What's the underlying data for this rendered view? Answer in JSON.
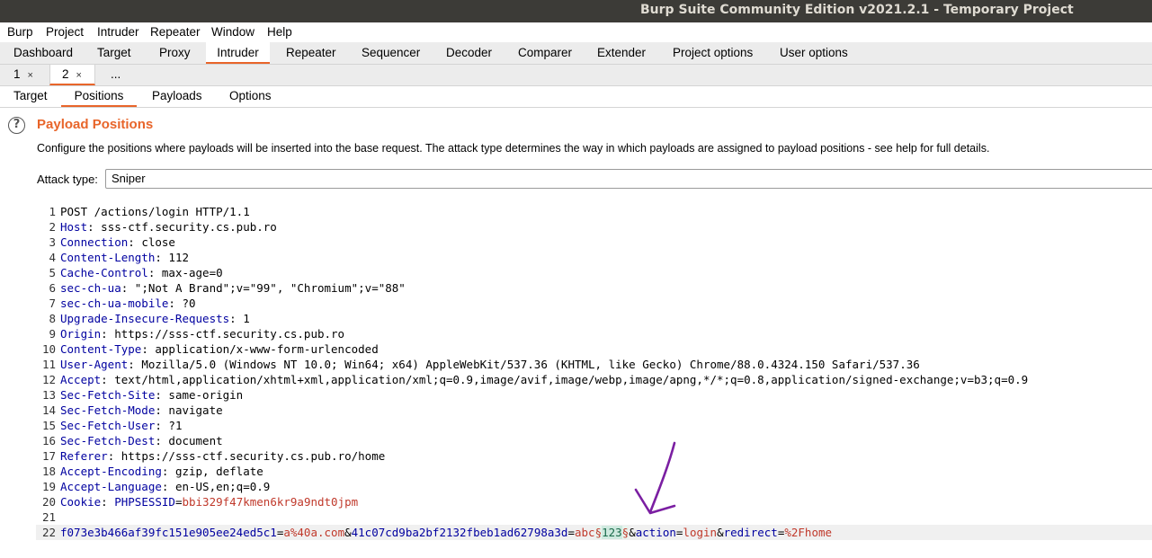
{
  "window": {
    "title": "Burp Suite Community Edition v2021.2.1 - Temporary Project"
  },
  "menu": [
    "Burp",
    "Project",
    "Intruder",
    "Repeater",
    "Window",
    "Help"
  ],
  "tabs": [
    "Dashboard",
    "Target",
    "Proxy",
    "Intruder",
    "Repeater",
    "Sequencer",
    "Decoder",
    "Comparer",
    "Extender",
    "Project options",
    "User options"
  ],
  "active_tab": "Intruder",
  "attack_tabs": [
    {
      "label": "1",
      "close": "×"
    },
    {
      "label": "2",
      "close": "×"
    },
    {
      "label": "..."
    }
  ],
  "intruder_tabs": [
    "Target",
    "Positions",
    "Payloads",
    "Options"
  ],
  "positions": {
    "help_icon": "?",
    "title": "Payload Positions",
    "description": "Configure the positions where payloads will be inserted into the base request. The attack type determines the way in which payloads are assigned to payload positions - see help for full details.",
    "attack_type_label": "Attack type:",
    "attack_type_value": "Sniper"
  },
  "request": {
    "lines": [
      {
        "n": "1",
        "k": "",
        "v": "POST /actions/login HTTP/1.1"
      },
      {
        "n": "2",
        "k": "Host",
        "v": " sss-ctf.security.cs.pub.ro"
      },
      {
        "n": "3",
        "k": "Connection",
        "v": " close"
      },
      {
        "n": "4",
        "k": "Content-Length",
        "v": " 112"
      },
      {
        "n": "5",
        "k": "Cache-Control",
        "v": " max-age=0"
      },
      {
        "n": "6",
        "k": "sec-ch-ua",
        "v": " \";Not A Brand\";v=\"99\", \"Chromium\";v=\"88\""
      },
      {
        "n": "7",
        "k": "sec-ch-ua-mobile",
        "v": " ?0"
      },
      {
        "n": "8",
        "k": "Upgrade-Insecure-Requests",
        "v": " 1"
      },
      {
        "n": "9",
        "k": "Origin",
        "v": " https://sss-ctf.security.cs.pub.ro"
      },
      {
        "n": "10",
        "k": "Content-Type",
        "v": " application/x-www-form-urlencoded"
      },
      {
        "n": "11",
        "k": "User-Agent",
        "v": " Mozilla/5.0 (Windows NT 10.0; Win64; x64) AppleWebKit/537.36 (KHTML, like Gecko) Chrome/88.0.4324.150 Safari/537.36"
      },
      {
        "n": "12",
        "k": "Accept",
        "v": " text/html,application/xhtml+xml,application/xml;q=0.9,image/avif,image/webp,image/apng,*/*;q=0.8,application/signed-exchange;v=b3;q=0.9"
      },
      {
        "n": "13",
        "k": "Sec-Fetch-Site",
        "v": " same-origin"
      },
      {
        "n": "14",
        "k": "Sec-Fetch-Mode",
        "v": " navigate"
      },
      {
        "n": "15",
        "k": "Sec-Fetch-User",
        "v": " ?1"
      },
      {
        "n": "16",
        "k": "Sec-Fetch-Dest",
        "v": " document"
      },
      {
        "n": "17",
        "k": "Referer",
        "v": " https://sss-ctf.security.cs.pub.ro/home"
      },
      {
        "n": "18",
        "k": "Accept-Encoding",
        "v": " gzip, deflate"
      },
      {
        "n": "19",
        "k": "Accept-Language",
        "v": " en-US,en;q=0.9"
      }
    ],
    "cookie": {
      "n": "20",
      "k": "Cookie",
      "name": " PHPSESSID",
      "eq": "=",
      "value": "bbi329f47kmen6kr9a9ndt0jpm"
    },
    "blank": {
      "n": "21"
    },
    "body": {
      "n": "22",
      "p1_name": "f073e3b466af39fc151e905ee24ed5c1",
      "p1_value": "a%40a.com",
      "p2_name": "41c07cd9ba2bf2132fbeb1ad62798a3d",
      "p2_prefix": "abc",
      "marker_open": "§",
      "payload": "123",
      "marker_close": "§",
      "p3_name": "action",
      "p3_value": "login",
      "p4_name": "redirect",
      "p4_value": "%2Fhome"
    }
  },
  "colors": {
    "accent": "#e8652a",
    "header_key": "#0000a0",
    "value_red": "#c0392b",
    "arrow": "#7b1fa2"
  }
}
